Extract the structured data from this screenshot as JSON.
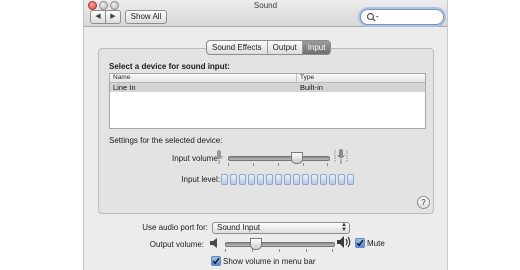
{
  "window": {
    "title": "Sound"
  },
  "toolbar": {
    "back": "◀",
    "forward": "▶",
    "show_all": "Show All"
  },
  "tabs": [
    {
      "label": "Sound Effects"
    },
    {
      "label": "Output"
    },
    {
      "label": "Input",
      "active": true
    }
  ],
  "input": {
    "heading": "Select a device for sound input:",
    "columns": [
      "Name",
      "Type"
    ],
    "rows": [
      {
        "name": "Line In",
        "type": "Built-in",
        "selected": true
      }
    ],
    "settings_label": "Settings for the selected device:",
    "volume_label": "Input volume:",
    "volume_fraction": 0.68,
    "level_label": "Input level:",
    "level_segments": 15,
    "level_lit": 0
  },
  "help": "?",
  "bottom": {
    "port_label": "Use audio port for:",
    "port_value": "Sound Input",
    "output_label": "Output volume:",
    "output_fraction": 0.28,
    "mute_label": "Mute",
    "mute_checked": true,
    "menubar_label": "Show volume in menu bar",
    "menubar_checked": true
  }
}
